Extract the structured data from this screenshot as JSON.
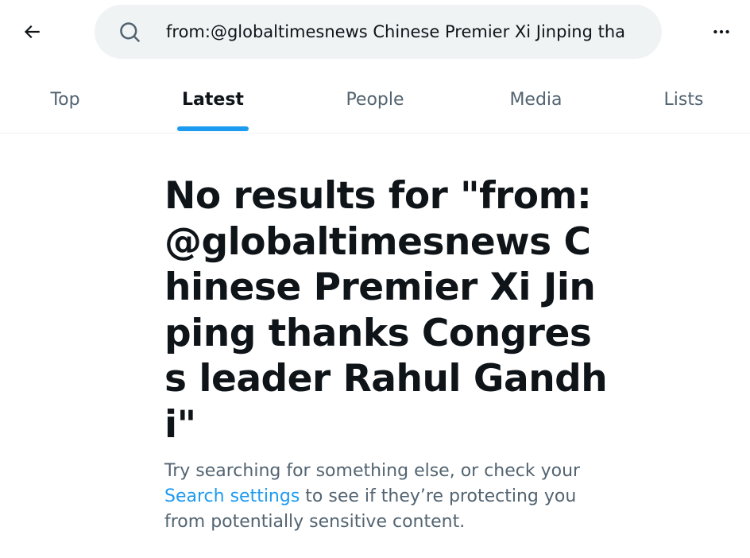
{
  "header": {
    "back_icon": "arrow-left-icon",
    "search_icon": "search-icon",
    "search_value": "from:@globaltimesnews Chinese Premier Xi Jinping tha",
    "more_icon": "more-horizontal-icon"
  },
  "tabs": [
    {
      "label": "Top",
      "active": false
    },
    {
      "label": "Latest",
      "active": true
    },
    {
      "label": "People",
      "active": false
    },
    {
      "label": "Media",
      "active": false
    },
    {
      "label": "Lists",
      "active": false
    }
  ],
  "empty_state": {
    "title": "No results for \"from:@globaltimesnews Chinese Premier Xi Jinping thanks Congress leader Rahul Gandhi\"",
    "message_before": "Try searching for something else, or check your ",
    "link_label": "Search settings",
    "message_after": " to see if they’re protecting you from potentially sensitive content."
  },
  "colors": {
    "accent": "#1d9bf0",
    "text_primary": "#0f1419",
    "text_secondary": "#536471",
    "search_bg": "#eff3f4"
  }
}
